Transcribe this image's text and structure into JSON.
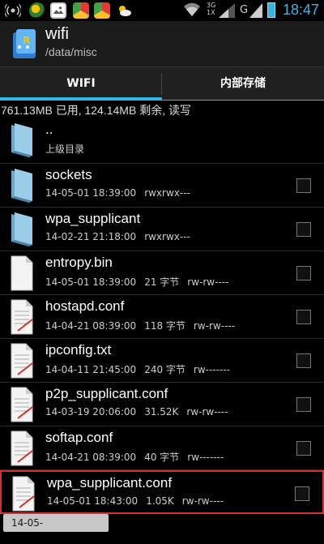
{
  "status": {
    "time": "18:47",
    "network": "3G",
    "network2": "1X",
    "g": "G",
    "icons": [
      "signal-icon",
      "app-icon",
      "gallery-icon",
      "chrome-icon",
      "chrome-icon",
      "weather-icon",
      "wifi-icon",
      "battery-icon"
    ]
  },
  "app": {
    "title": "wifi",
    "path": "/data/misc"
  },
  "tabs": [
    {
      "label": "WIFI",
      "active": true
    },
    {
      "label": "内部存储",
      "active": false
    }
  ],
  "storage_info": "761.13MB 已用, 124.14MB 剩余, 读写",
  "files": [
    {
      "name": "..",
      "date": "上级目录",
      "perm": "",
      "size": "",
      "type": "parent",
      "checkbox": false
    },
    {
      "name": "sockets",
      "date": "14-05-01 18:39:00",
      "size": "",
      "perm": "rwxrwx---",
      "type": "folder",
      "checkbox": true
    },
    {
      "name": "wpa_supplicant",
      "date": "14-02-21 21:18:00",
      "size": "",
      "perm": "rwxrwx---",
      "type": "folder",
      "checkbox": true
    },
    {
      "name": "entropy.bin",
      "date": "14-05-01 18:39:00",
      "size": "21 字节",
      "perm": "rw-rw----",
      "type": "file",
      "checkbox": true
    },
    {
      "name": "hostapd.conf",
      "date": "14-04-21 08:39:00",
      "size": "118 字节",
      "perm": "rw-rw----",
      "type": "textfile",
      "checkbox": true
    },
    {
      "name": "ipconfig.txt",
      "date": "14-04-11 21:45:00",
      "size": "240 字节",
      "perm": "rw-------",
      "type": "textfile",
      "checkbox": true
    },
    {
      "name": "p2p_supplicant.conf",
      "date": "14-03-19 20:06:00",
      "size": "31.52K",
      "perm": "rw-rw----",
      "type": "textfile",
      "checkbox": true
    },
    {
      "name": "softap.conf",
      "date": "14-04-21 08:39:00",
      "size": "40 字节",
      "perm": "rw-------",
      "type": "textfile",
      "checkbox": true
    },
    {
      "name": "wpa_supplicant.conf",
      "date": "14-05-01 18:43:00",
      "size": "1.05K",
      "perm": "rw-rw----",
      "type": "textfile",
      "checkbox": true,
      "selected": true
    }
  ],
  "toast": "14-05-",
  "colors": {
    "accent": "#33b5e5",
    "selection": "#d32f2f",
    "background": "#000000"
  }
}
